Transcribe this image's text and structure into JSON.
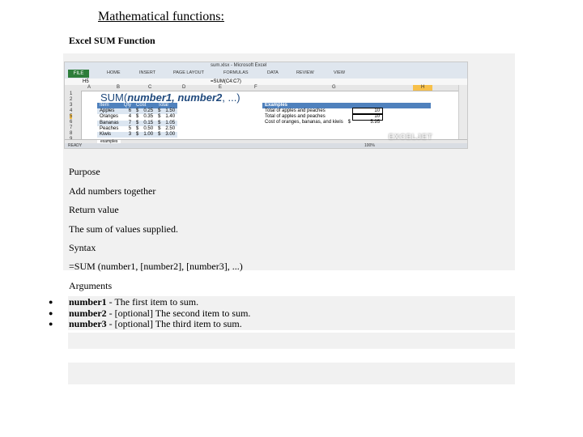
{
  "page_title": "Mathematical functions:",
  "subtitle": "Excel SUM Function",
  "excel": {
    "file_tab": "FILE",
    "tabs": [
      "HOME",
      "INSERT",
      "PAGE LAYOUT",
      "FORMULAS",
      "DATA",
      "REVIEW",
      "VIEW"
    ],
    "window_title": "sum.xlsx - Microsoft Excel",
    "name_box": "H5",
    "formula": "=SUM(C4:C7)",
    "columns": [
      "A",
      "B",
      "C",
      "D",
      "E",
      "F",
      "G",
      "H"
    ],
    "rows": [
      "1",
      "2",
      "3",
      "4",
      "5",
      "6",
      "7",
      "8",
      "9"
    ],
    "big_formula_prefix": "SUM(",
    "big_formula_args": "number1, number2",
    "big_formula_suffix": ", ...)",
    "table_headers": [
      "Item",
      "Qty",
      "Cost",
      "Total"
    ],
    "table_rows": [
      [
        "Apples",
        "6",
        "$",
        "0.25",
        "$",
        "1.50"
      ],
      [
        "Oranges",
        "4",
        "$",
        "0.35",
        "$",
        "1.40"
      ],
      [
        "Bananas",
        "7",
        "$",
        "0.15",
        "$",
        "1.05"
      ],
      [
        "Peaches",
        "5",
        "$",
        "0.50",
        "$",
        "2.50"
      ],
      [
        "Kiwis",
        "3",
        "$",
        "1.00",
        "$",
        "3.00"
      ]
    ],
    "examples_title": "Examples",
    "examples": [
      {
        "label": "Total of apples and peaches",
        "value": "10"
      },
      {
        "label": "Total of apples and peaches",
        "value": "10"
      },
      {
        "label": "Cost of oranges, bananas, and kiwis",
        "currency": "$",
        "value": "5.95"
      }
    ],
    "sheet_tab": "examples",
    "status_ready": "READY",
    "zoom": "100%",
    "watermark": "EXCELJET"
  },
  "sections": {
    "purpose_heading": "Purpose",
    "purpose_text": "Add numbers together",
    "return_heading": "Return value",
    "return_text": "The sum of values supplied.",
    "syntax_heading": "Syntax",
    "syntax_text": "=SUM (number1, [number2], [number3], ...)",
    "arguments_heading": "Arguments"
  },
  "arguments": [
    {
      "name": "number1",
      "desc": " - The first item to sum."
    },
    {
      "name": "number2",
      "desc": " - [optional] The second item to sum."
    },
    {
      "name": "number3",
      "desc": " - [optional] The third item to sum."
    }
  ],
  "colors": {
    "panel_bg": "#f1f1f1",
    "table_header": "#4f81bd",
    "table_band": "#dce6f1",
    "file_tab": "#2d7d3a",
    "selected_header": "#f7c04a"
  }
}
